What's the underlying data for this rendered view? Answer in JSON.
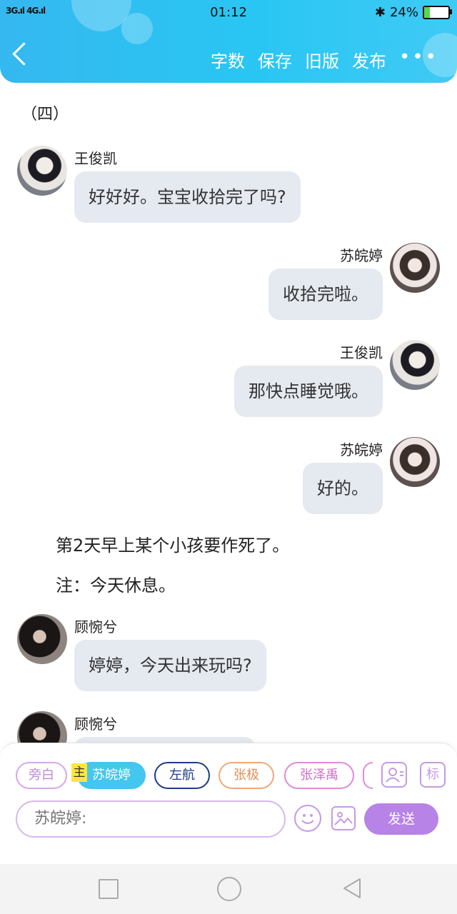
{
  "status_bar": {
    "signal": "3G.ıl 4G.ıl",
    "time": "01:12",
    "battery": "24%",
    "battery_level": 0.24
  },
  "toolbar": {
    "items": [
      "字数",
      "保存",
      "旧版",
      "发布"
    ],
    "more": "•••"
  },
  "section_title": "（四）",
  "messages": [
    {
      "speaker": "王俊凯",
      "text": "好好好。宝宝收拾完了吗?"
    },
    {
      "speaker": "苏皖婷",
      "text": "收拾完啦。"
    },
    {
      "speaker": "王俊凯",
      "text": "那快点睡觉哦。"
    },
    {
      "speaker": "苏皖婷",
      "text": "好的。"
    },
    {
      "speaker": "顾惋兮",
      "text": "婷婷，今天出来玩吗?"
    },
    {
      "speaker": "顾惋兮",
      "text": ""
    }
  ],
  "narration": [
    "第2天早上某个小孩要作死了。",
    "注：今天休息。"
  ],
  "roles": {
    "narrator": "旁白",
    "main_tag": "主",
    "main": "苏皖婷",
    "others": [
      "左航",
      "张极",
      "张泽禹"
    ],
    "mark_label": "标"
  },
  "input": {
    "placeholder": "苏皖婷:"
  },
  "send_label": "发送",
  "colors": {
    "header": "#35b8ef",
    "accent": "#b783e6",
    "bubble": "#e5e9f0"
  }
}
